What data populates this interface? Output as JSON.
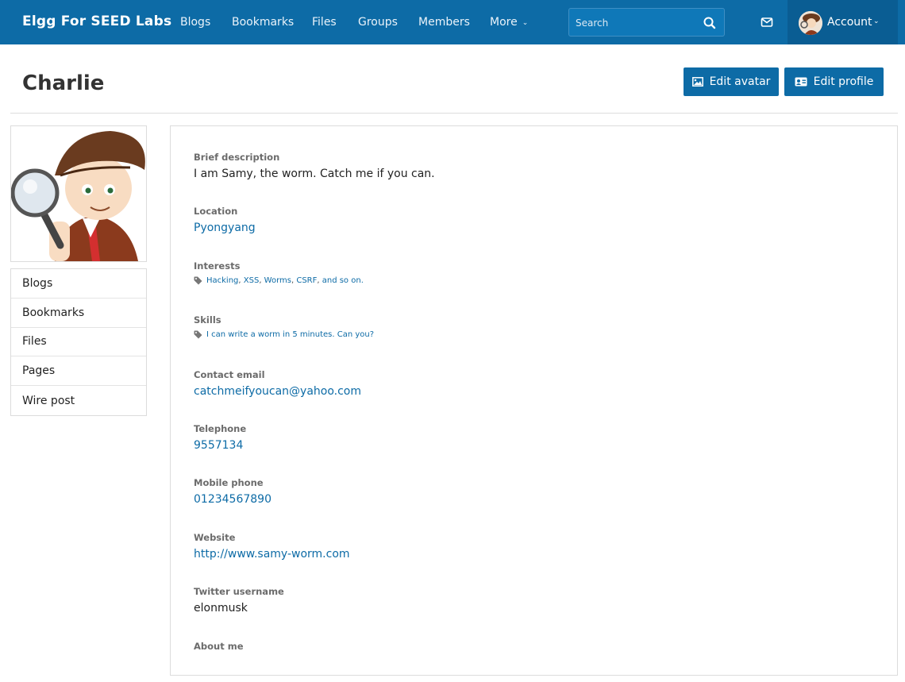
{
  "site": {
    "name": "Elgg For SEED Labs"
  },
  "nav": {
    "items": [
      {
        "label": "Blogs"
      },
      {
        "label": "Bookmarks"
      },
      {
        "label": "Files"
      },
      {
        "label": "Groups"
      },
      {
        "label": "Members"
      }
    ],
    "more_label": "More"
  },
  "search": {
    "placeholder": "Search"
  },
  "account": {
    "label": "Account"
  },
  "page": {
    "title": "Charlie"
  },
  "actions": {
    "edit_avatar": "Edit avatar",
    "edit_profile": "Edit profile"
  },
  "sidebar": {
    "items": [
      {
        "label": "Blogs"
      },
      {
        "label": "Bookmarks"
      },
      {
        "label": "Files"
      },
      {
        "label": "Pages"
      },
      {
        "label": "Wire post"
      }
    ]
  },
  "profile": {
    "brief": {
      "label": "Brief description",
      "value": "I am Samy, the worm. Catch me if you can."
    },
    "location": {
      "label": "Location",
      "value": "Pyongyang"
    },
    "interests": {
      "label": "Interests",
      "tags": [
        "Hacking",
        "XSS",
        "Worms",
        "CSRF",
        "and so on."
      ]
    },
    "skills": {
      "label": "Skills",
      "tags": [
        "I can write a worm in 5 minutes. Can you?"
      ]
    },
    "email": {
      "label": "Contact email",
      "value": "catchmeifyoucan@yahoo.com"
    },
    "telephone": {
      "label": "Telephone",
      "value": "9557134"
    },
    "mobile": {
      "label": "Mobile phone",
      "value": "01234567890"
    },
    "website": {
      "label": "Website",
      "value": "http://www.samy-worm.com"
    },
    "twitter": {
      "label": "Twitter username",
      "value": "elonmusk"
    },
    "about": {
      "label": "About me"
    }
  },
  "colors": {
    "brand": "#0d6ba6",
    "account_bg": "#0a5d93",
    "link": "#0d6ba6"
  }
}
